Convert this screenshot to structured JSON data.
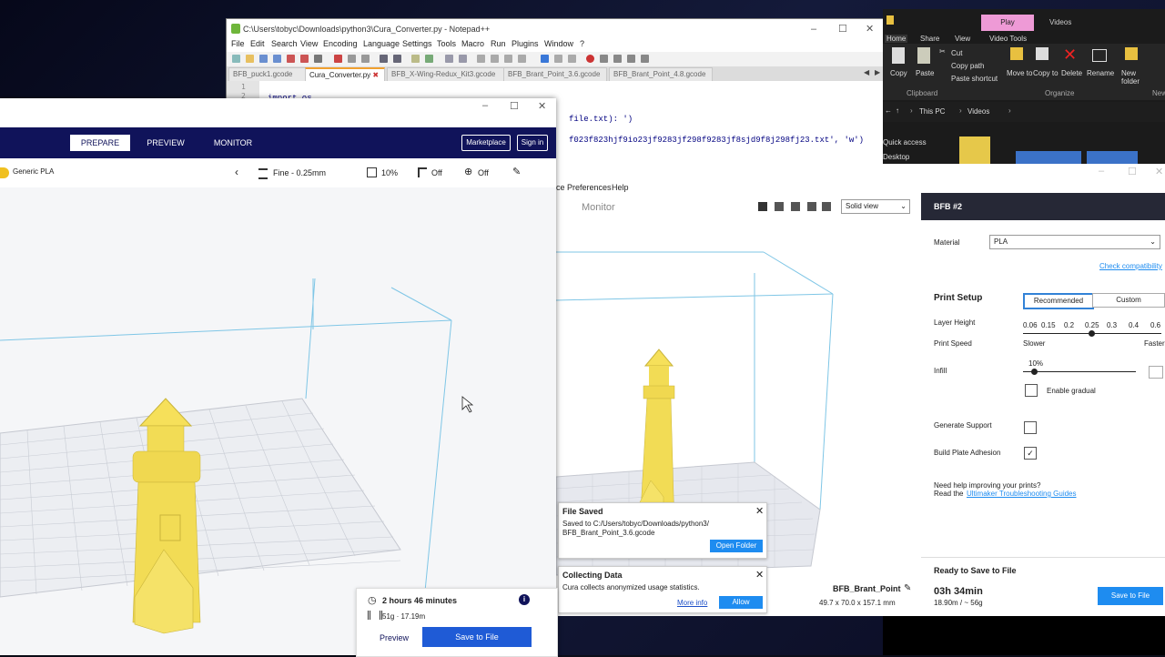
{
  "notepad": {
    "title": "C:\\Users\\tobyc\\Downloads\\python3\\Cura_Converter.py - Notepad++",
    "menu": [
      "File",
      "Edit",
      "Search",
      "View",
      "Encoding",
      "Language",
      "Settings",
      "Tools",
      "Macro",
      "Run",
      "Plugins",
      "Window",
      "?"
    ],
    "tabs": [
      {
        "label": "BFB_puck1.gcode",
        "active": false
      },
      {
        "label": "Cura_Converter.py",
        "active": true
      },
      {
        "label": "BFB_X-Wing-Redux_Kit3.gcode",
        "active": false
      },
      {
        "label": "BFB_Brant_Point_3.6.gcode",
        "active": false
      },
      {
        "label": "BFB_Brant_Point_4.8.gcode",
        "active": false
      }
    ],
    "line_numbers": [
      "1",
      "2",
      "3"
    ],
    "code_line_1": "import os",
    "code_line_2": "file.txt): ')",
    "code_line_3": "f023f823hjf9io23jf9283jf298f9283jf8sjd9f8j298fj23.txt', 'w')"
  },
  "explorer": {
    "tabs": [
      "Play",
      "Videos"
    ],
    "ribbon_tabs": [
      "Home",
      "Share",
      "View",
      "Video Tools"
    ],
    "clipboard_items": [
      "Copy",
      "Paste"
    ],
    "clipboard_small": [
      "Cut",
      "Copy path",
      "Paste shortcut"
    ],
    "clipboard_label": "Clipboard",
    "organize_items": [
      "Move to",
      "Copy to",
      "Delete",
      "Rename"
    ],
    "organize_label": "Organize",
    "new_folder": "New folder",
    "new_label": "New",
    "address": "This PC",
    "address_child": "Videos",
    "nav_items": [
      "Quick access",
      "Desktop"
    ]
  },
  "cura_bg": {
    "menu": [
      "ce",
      "Preferences",
      "Help"
    ],
    "monitor_label": "Monitor",
    "view_select": "Solid view",
    "printer_name": "BFB #2",
    "material_label": "Material",
    "material_value": "PLA",
    "check_compat": "Check compatibility",
    "print_setup": "Print Setup",
    "recommended": "Recommended",
    "custom": "Custom",
    "layer_height_label": "Layer Height",
    "layer_values": [
      "0.06",
      "0.15",
      "0.2",
      "0.25",
      "0.3",
      "0.4",
      "0.6"
    ],
    "print_speed_label": "Print Speed",
    "slower": "Slower",
    "faster": "Faster",
    "infill_label": "Infill",
    "infill_value": "10%",
    "enable_gradual": "Enable gradual",
    "generate_support": "Generate Support",
    "build_plate_adhesion": "Build Plate Adhesion",
    "help_line1": "Need help improving your prints?",
    "help_line2_prefix": "Read the",
    "help_link": "Ultimaker Troubleshooting Guides",
    "ready_label": "Ready to Save to File",
    "time": "03h 34min",
    "material_usage": "18.90m / ~ 56g",
    "save_button": "Save to File",
    "object_name": "BFB_Brant_Point",
    "object_dims": "49.7 x 70.0 x 157.1 mm",
    "toast_saved_title": "File Saved",
    "toast_saved_text1": "Saved to C:/Users/tobyc/Downloads/python3/",
    "toast_saved_text2": "BFB_Brant_Point_3.6.gcode",
    "open_folder": "Open Folder",
    "toast_collect_title": "Collecting Data",
    "toast_collect_text": "Cura collects anonymized usage statistics.",
    "more_info": "More info",
    "allow": "Allow"
  },
  "cura_fg": {
    "nav": [
      "PREPARE",
      "PREVIEW",
      "MONITOR"
    ],
    "marketplace": "Marketplace",
    "sign_in": "Sign in",
    "material": "Generic PLA",
    "profile": "Fine - 0.25mm",
    "infill": "10%",
    "support": "Off",
    "adhesion": "Off",
    "print_time": "2 hours 46 minutes",
    "material_usage": "51g · 17.19m",
    "preview_button": "Preview",
    "save_button": "Save to File"
  }
}
